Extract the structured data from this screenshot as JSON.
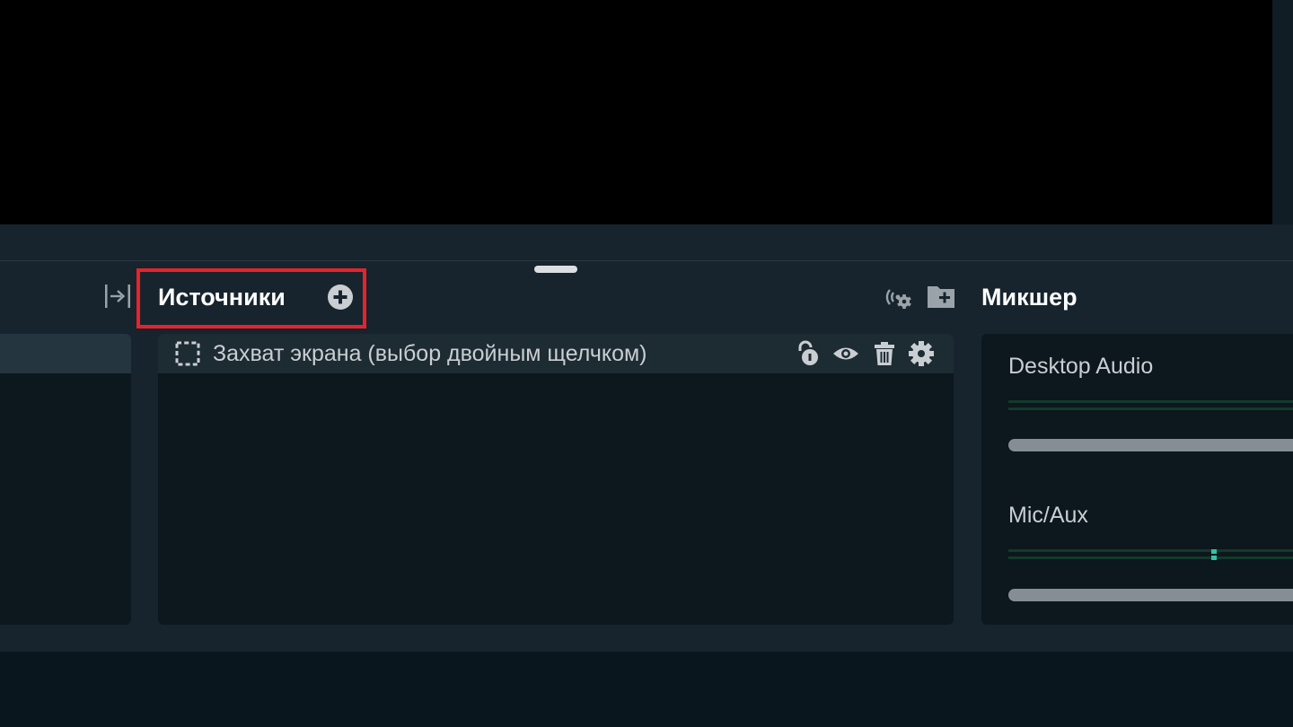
{
  "sources": {
    "title": "Источники",
    "items": [
      {
        "name": "Захват экрана (выбор двойным щелчком)",
        "type_icon": "dashed-selection-icon"
      }
    ],
    "row_icons": [
      "lock-open-icon",
      "eye-icon",
      "trash-icon",
      "gear-icon"
    ],
    "header_icons": [
      "collapse-right-icon",
      "plus-circle-icon"
    ],
    "highlight_color": "#e5232c"
  },
  "mixer": {
    "title": "Микшер",
    "header_icons": [
      "advanced-audio-settings-icon",
      "add-folder-icon"
    ],
    "channels": [
      {
        "name": "Desktop Audio"
      },
      {
        "name": "Mic/Aux"
      }
    ]
  },
  "colors": {
    "background": "#09161d",
    "dock": "#17242d",
    "panel": "#0c171e",
    "row_selected": "#1d2b33",
    "meter_green": "#31c3a2",
    "fader": "#858e94"
  }
}
